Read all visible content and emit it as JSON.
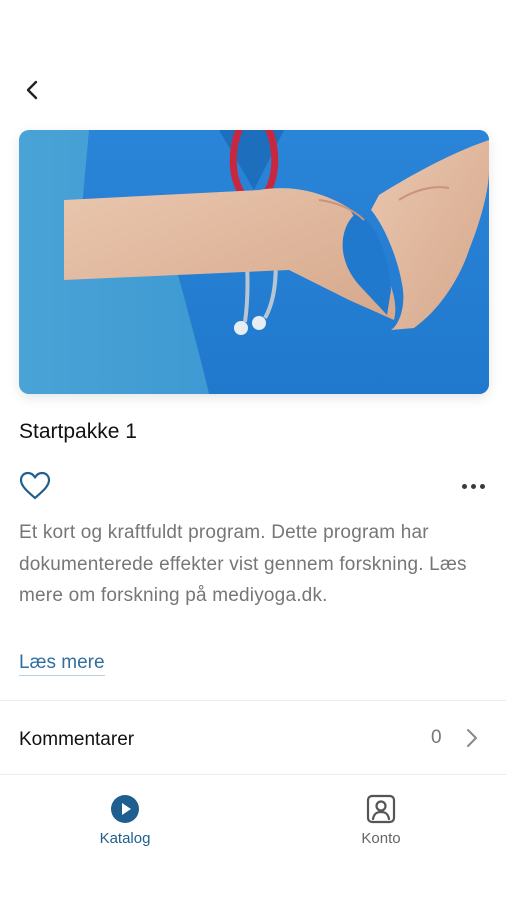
{
  "product": {
    "title": "Startpakke 1",
    "description": "Et kort og kraftfuldt program. Dette program har dokumenterede effekter vist gennem forskning. Læs mere om forskning på mediyoga.dk.",
    "read_more_label": "Læs mere",
    "image_subject": "nurse in blue scrubs with stethoscope forming heart shape with hands"
  },
  "comments": {
    "label": "Kommentarer",
    "count": "0"
  },
  "tabs": [
    {
      "label": "Katalog",
      "icon": "play-circle-icon",
      "active": true
    },
    {
      "label": "Konto",
      "icon": "user-account-icon",
      "active": false
    }
  ],
  "colors": {
    "accent": "#1f5f8f",
    "link": "#2f6fa1",
    "scrubs": "#2b86d6",
    "background_image": "#3d9ad1"
  }
}
